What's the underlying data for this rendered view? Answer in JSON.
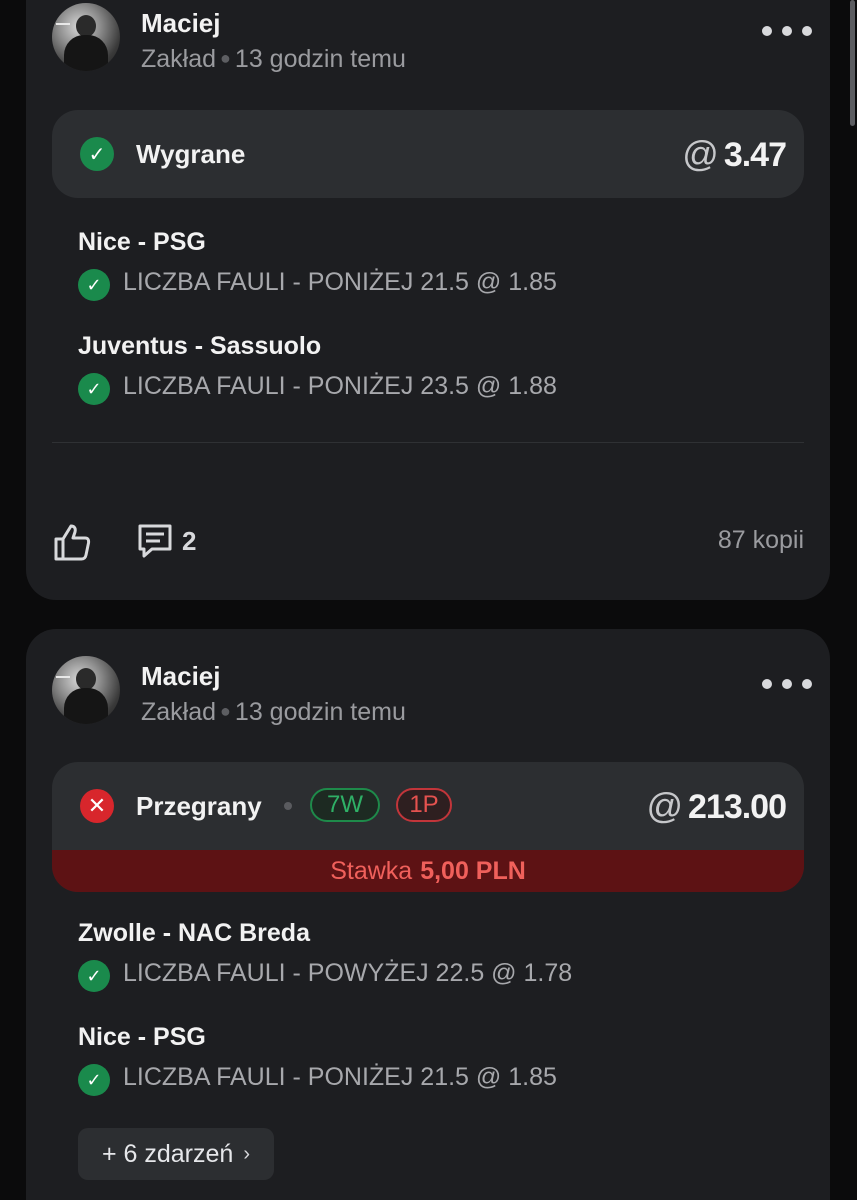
{
  "posts": [
    {
      "user": "Maciej",
      "type": "Zakład",
      "time": "13 godzin temu",
      "status": "Wygrane",
      "odds_at": "@",
      "odds": "3.47",
      "selections": [
        {
          "match": "Nice - PSG",
          "line": "LICZBA FAULI - PONIŻEJ 21.5 @ 1.85"
        },
        {
          "match": "Juventus - Sassuolo",
          "line": "LICZBA FAULI - PONIŻEJ 23.5 @ 1.88"
        }
      ],
      "comments": "2",
      "copies": "87 kopii"
    },
    {
      "user": "Maciej",
      "type": "Zakład",
      "time": "13 godzin temu",
      "status": "Przegrany",
      "wins_badge": "7W",
      "losses_badge": "1P",
      "odds_at": "@",
      "odds": "213.00",
      "stake_label": "Stawka",
      "stake_value": "5,00 PLN",
      "selections": [
        {
          "match": "Zwolle - NAC Breda",
          "line": "LICZBA FAULI - POWYŻEJ 22.5 @ 1.78"
        },
        {
          "match": "Nice - PSG",
          "line": "LICZBA FAULI - PONIŻEJ 21.5 @ 1.85"
        }
      ],
      "more_events": "+ 6 zdarzeń"
    }
  ],
  "icons": {
    "check": "check-icon",
    "cross": "cross-icon",
    "like": "thumbs-up-icon",
    "comment": "comment-icon",
    "more": "more-dots-icon",
    "chevron": "chevron-right-icon"
  },
  "colors": {
    "win": "#1a8a4c",
    "lose": "#d8262c",
    "stake_bg": "#5d1214",
    "stake_text": "#f0605b",
    "card_bg": "#1d1e21",
    "page_bg": "#0b0b0c"
  }
}
